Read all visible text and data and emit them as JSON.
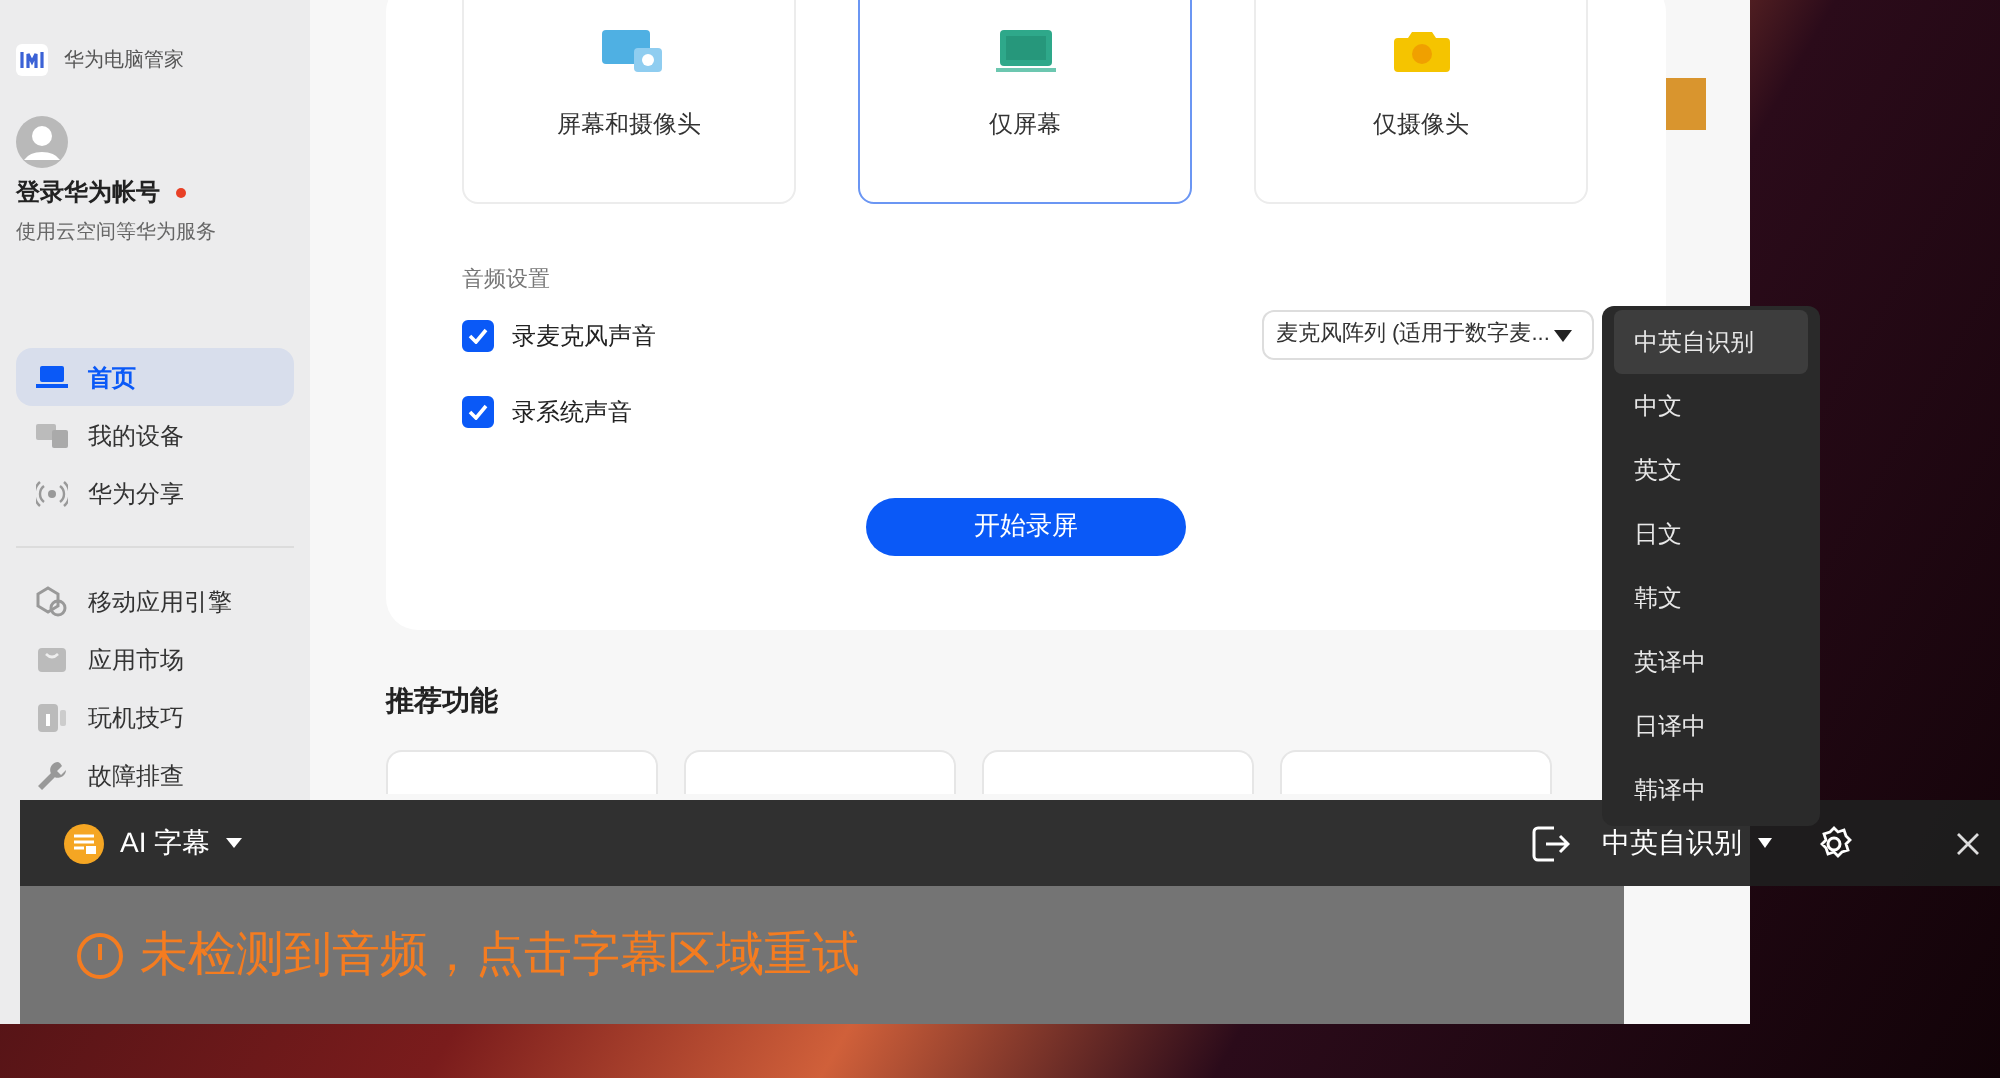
{
  "app": {
    "title": "华为电脑管家"
  },
  "account": {
    "title": "登录华为帐号",
    "notice": true,
    "subtitle": "使用云空间等华为服务"
  },
  "sidebar": {
    "groups": [
      [
        {
          "label": "首页",
          "selected": true
        },
        {
          "label": "我的设备",
          "selected": false
        },
        {
          "label": "华为分享",
          "selected": false
        }
      ],
      [
        {
          "label": "移动应用引擎",
          "selected": false
        },
        {
          "label": "应用市场",
          "selected": false
        },
        {
          "label": "玩机技巧",
          "selected": false
        },
        {
          "label": "故障排查",
          "selected": false
        }
      ]
    ]
  },
  "record": {
    "modes": [
      {
        "label": "屏幕和摄像头",
        "selected": false
      },
      {
        "label": "仅屏幕",
        "selected": true
      },
      {
        "label": "仅摄像头",
        "selected": false
      }
    ],
    "audio_title": "音频设置",
    "options": [
      {
        "label": "录麦克风声音",
        "checked": true,
        "select": "麦克风阵列 (适用于数字麦..."
      },
      {
        "label": "录系统声音",
        "checked": true
      }
    ],
    "start_button": "开始录屏"
  },
  "recommended": {
    "title": "推荐功能"
  },
  "caption": {
    "title": "AI 字幕",
    "language": "中英自识别",
    "message": "未检测到音频，点击字幕区域重试",
    "languages": [
      {
        "label": "中英自识别",
        "selected": true
      },
      {
        "label": "中文",
        "selected": false
      },
      {
        "label": "英文",
        "selected": false
      },
      {
        "label": "日文",
        "selected": false
      },
      {
        "label": "韩文",
        "selected": false
      },
      {
        "label": "英译中",
        "selected": false
      },
      {
        "label": "日译中",
        "selected": false
      },
      {
        "label": "韩译中",
        "selected": false
      }
    ]
  }
}
